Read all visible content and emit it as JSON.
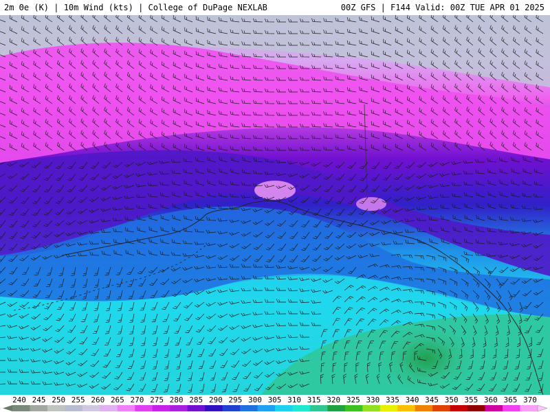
{
  "header": {
    "left_text": "2m Θe (K) | 10m Wind (kts) | College of DuPage NEXLAB",
    "right_text": "00Z GFS | F144 Valid: 00Z TUE APR 01 2025"
  },
  "map": {
    "field": "equivalent potential temperature",
    "overlay": "wind barbs",
    "region": "Alaska / NE Pacific"
  },
  "colorbar": {
    "ticks": [
      "240",
      "245",
      "250",
      "255",
      "260",
      "265",
      "270",
      "275",
      "280",
      "285",
      "290",
      "295",
      "300",
      "305",
      "310",
      "315",
      "320",
      "325",
      "330",
      "335",
      "340",
      "345",
      "350",
      "355",
      "360",
      "365",
      "370"
    ],
    "colors": [
      "#7a8a7a",
      "#a0a8a0",
      "#c0c4c0",
      "#b8bcd0",
      "#d0c8e0",
      "#e0b0f0",
      "#f080f8",
      "#e040f0",
      "#c820e8",
      "#a820e0",
      "#7010d0",
      "#3010c0",
      "#2040d0",
      "#2070e0",
      "#20a0f0",
      "#20d0f0",
      "#20e8d0",
      "#30c890",
      "#20a040",
      "#40c020",
      "#90e020",
      "#e8f000",
      "#f8c000",
      "#f08000",
      "#e04000",
      "#c80000",
      "#900000",
      "#d000a0",
      "#f040f0",
      "#f8a0f8"
    ]
  }
}
